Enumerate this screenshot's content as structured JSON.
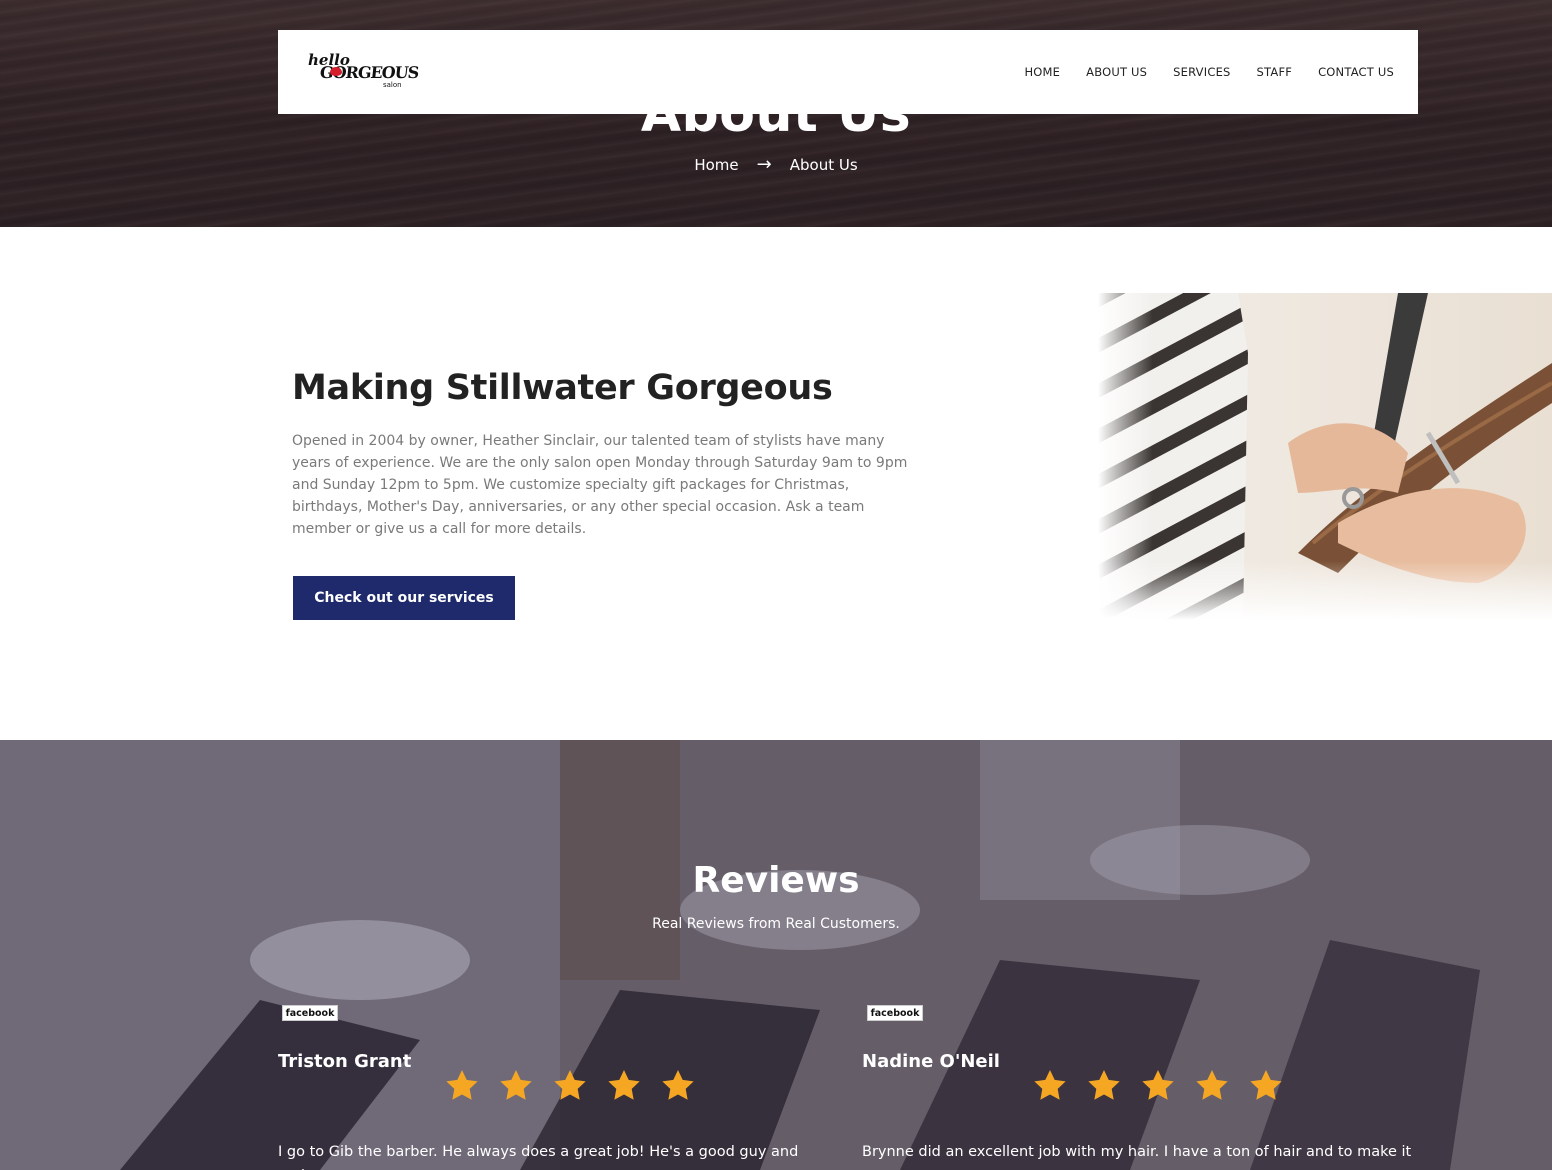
{
  "hero": {
    "title": "About Us",
    "breadcrumb": {
      "home": "Home",
      "separator": "→",
      "current": "About Us"
    }
  },
  "navbar": {
    "logo": {
      "line1": "hello",
      "line2": "GORGEOUS",
      "line3": "salon"
    },
    "items": [
      {
        "label": "HOME"
      },
      {
        "label": "ABOUT US"
      },
      {
        "label": "SERVICES"
      },
      {
        "label": "STAFF"
      },
      {
        "label": "CONTACT US"
      }
    ]
  },
  "about": {
    "heading": "Making Stillwater Gorgeous",
    "text": "Opened in 2004 by owner, Heather Sinclair, our talented team of stylists have many years of experience. We are the only salon open Monday through Saturday 9am to 9pm and Sunday 12pm to 5pm. We customize specialty gift packages for Christmas, birthdays, Mother's Day, anniversaries, or any other special occasion. Ask a team member or give us a call for more details.",
    "button_label": "Check out our services"
  },
  "reviews": {
    "title": "Reviews",
    "subtitle": "Real Reviews from Real Customers.",
    "star_color": "#f5a623",
    "items": [
      {
        "source": "facebook",
        "name": "Triston Grant",
        "rating": 5,
        "text": "I go to Gib the barber. He always does a great job! He's a good guy and makes"
      },
      {
        "source": "facebook",
        "name": "Nadine O'Neil",
        "rating": 5,
        "text": "Brynne did an excellent job with my hair. I have a ton of hair and to make it"
      }
    ]
  },
  "colors": {
    "button": "#1e2a6b",
    "hero_bg": "#2c2023"
  }
}
